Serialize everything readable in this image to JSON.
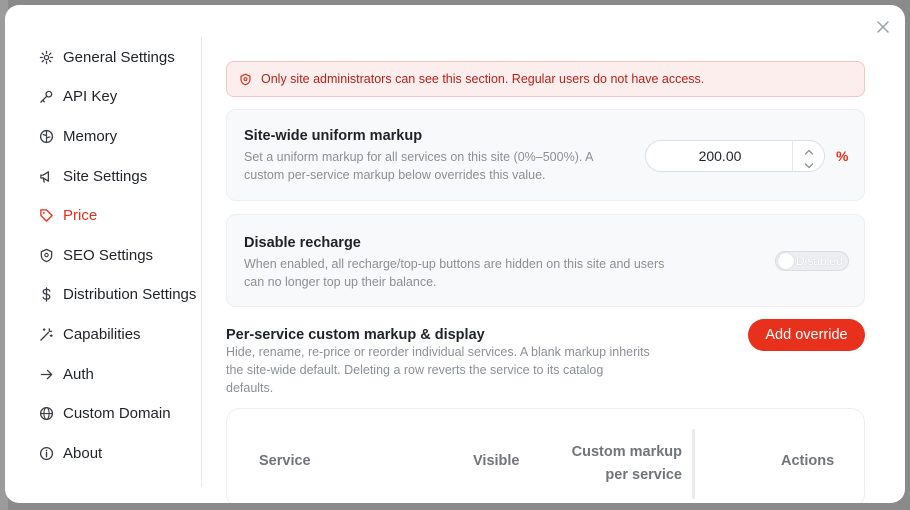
{
  "sidebar": {
    "items": [
      {
        "label": "General Settings",
        "icon": "gear-icon"
      },
      {
        "label": "API Key",
        "icon": "key-icon"
      },
      {
        "label": "Memory",
        "icon": "brain-icon"
      },
      {
        "label": "Site Settings",
        "icon": "megaphone-icon"
      },
      {
        "label": "Price",
        "icon": "tag-icon",
        "active": true
      },
      {
        "label": "SEO Settings",
        "icon": "shield-icon"
      },
      {
        "label": "Distribution Settings",
        "icon": "dollar-icon"
      },
      {
        "label": "Capabilities",
        "icon": "magic-wand-icon"
      },
      {
        "label": "Auth",
        "icon": "arrow-right-icon"
      },
      {
        "label": "Custom Domain",
        "icon": "globe-icon"
      },
      {
        "label": "About",
        "icon": "info-icon"
      }
    ]
  },
  "alert": {
    "text": "Only site administrators can see this section. Regular users do not have access.",
    "icon": "shield-alert-icon"
  },
  "markup_card": {
    "title": "Site-wide uniform markup",
    "desc_line1": "Set a uniform markup for all services on this site (0%–500%). A",
    "desc_line2": "custom per-service markup below overrides this value.",
    "value": "200.00",
    "unit": "%"
  },
  "recharge_card": {
    "title": "Disable recharge",
    "desc_line1": "When enabled, all recharge/top-up buttons are hidden on this site and users",
    "desc_line2": "can no longer top up their balance.",
    "toggle_label": "Disabled",
    "toggle_on": false
  },
  "overrides": {
    "title": "Per-service custom markup & display",
    "desc_line1": "Hide, rename, re-price or reorder individual services. A blank markup inherits",
    "desc_line2": "the site-wide default. Deleting a row reverts the service to its catalog",
    "desc_line3": "defaults.",
    "add_button": "Add override"
  },
  "table": {
    "col_service": "Service",
    "col_visible": "Visible",
    "col_markup_line1": "Custom markup",
    "col_markup_line2": "per service",
    "col_actions": "Actions"
  },
  "colors": {
    "accent": "#e8311d",
    "alert_bg": "#fdeeee",
    "alert_text": "#b4231a"
  }
}
